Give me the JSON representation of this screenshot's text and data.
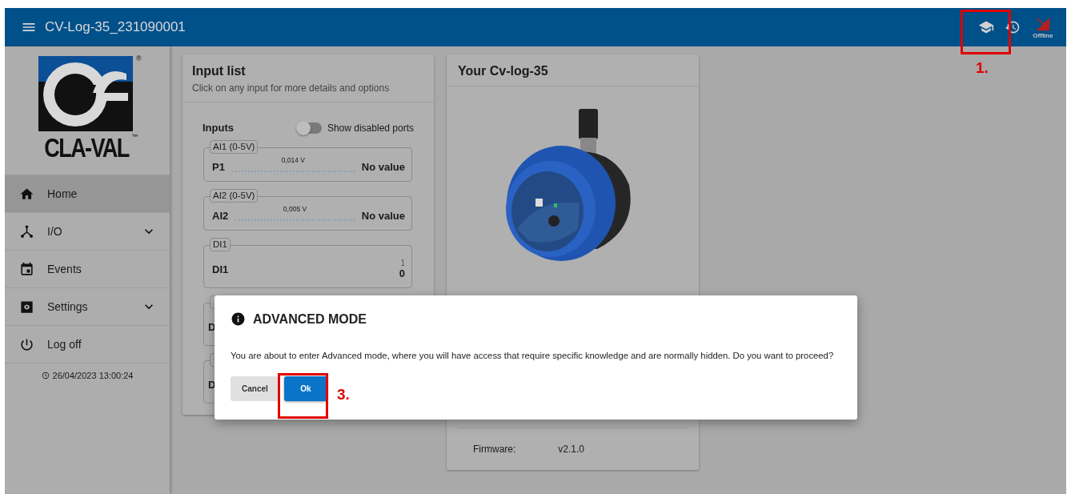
{
  "header": {
    "title": "CV-Log-35_231090001",
    "offline_label": "Offline",
    "annotation": "1."
  },
  "logo": {
    "text": "CLA-VAL",
    "registered": "®",
    "trademark": "™"
  },
  "sidebar": {
    "items": [
      {
        "label": "Home",
        "kind": "link",
        "selected": true
      },
      {
        "label": "I/O",
        "kind": "group",
        "selected": false
      },
      {
        "label": "Events",
        "kind": "link",
        "selected": false
      },
      {
        "label": "Settings",
        "kind": "group",
        "selected": false
      },
      {
        "label": "Log off",
        "kind": "link",
        "selected": false
      }
    ],
    "timestamp": "26/04/2023 13:00:24"
  },
  "input_list": {
    "title": "Input list",
    "subtitle": "Click on any input for more details and options",
    "section_label": "Inputs",
    "toggle": {
      "label": "Show disabled ports",
      "on": false
    },
    "inputs": [
      {
        "kind": "analog",
        "tag": "AI1 (0-5V)",
        "name": "P1",
        "reading": "0,014 V",
        "value": "No value"
      },
      {
        "kind": "analog",
        "tag": "AI2 (0-5V)",
        "name": "AI2",
        "reading": "0,005 V",
        "value": "No value"
      },
      {
        "kind": "digital",
        "tag": "DI1",
        "name": "DI1",
        "count": "1",
        "value": "0"
      },
      {
        "kind": "covered",
        "name": "D"
      },
      {
        "kind": "covered",
        "name": "D"
      }
    ]
  },
  "device": {
    "title": "Your Cv-log-35",
    "firmware_label": "Firmware:",
    "firmware": "v2.1.0"
  },
  "dialog": {
    "title": "ADVANCED MODE",
    "message": "You are about to enter Advanced mode, where you will have access that require specific knowledge and are normally hidden. Do you want to proceed?",
    "buttons": [
      {
        "label": "Cancel",
        "primary": false
      },
      {
        "label": "Ok",
        "primary": true,
        "annotation": "3."
      }
    ]
  }
}
